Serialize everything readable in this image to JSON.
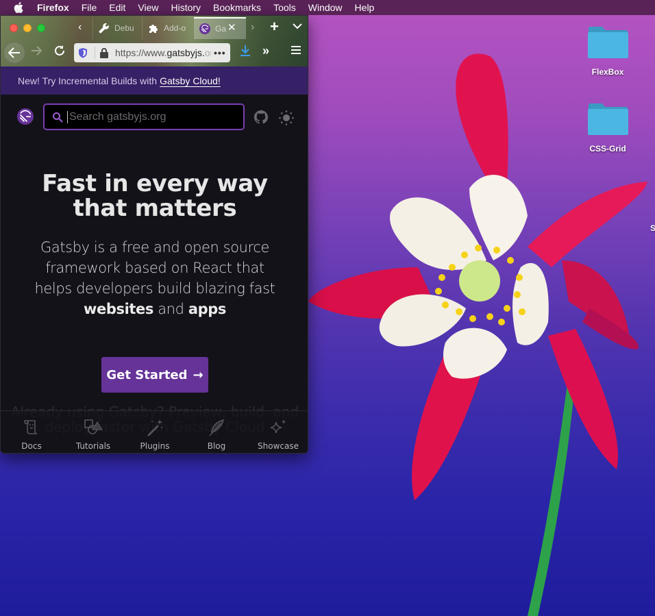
{
  "menubar": {
    "app_name": "Firefox",
    "items": [
      "File",
      "Edit",
      "View",
      "History",
      "Bookmarks",
      "Tools",
      "Window",
      "Help"
    ]
  },
  "desktop": {
    "icons": [
      {
        "label": "FlexBox",
        "icon": "folder-icon"
      },
      {
        "label": "CSS-Grid",
        "icon": "folder-icon"
      }
    ],
    "partial_label": "S"
  },
  "browser": {
    "tabs": [
      {
        "label": "Debu",
        "icon": "wrench-icon",
        "active": false
      },
      {
        "label": "Add-o",
        "icon": "puzzle-icon",
        "active": false
      },
      {
        "label": "Ga",
        "icon": "gatsby-icon",
        "active": true
      }
    ],
    "url_prefix": "https://www.",
    "url_domain": "gatsbyjs.",
    "url_suffix": "org",
    "page_actions": "•••"
  },
  "page": {
    "banner_text": "New! Try Incremental Builds with",
    "banner_link": "Gatsby Cloud!",
    "search_placeholder": "Search gatsbyjs.org",
    "hero_title_line1": "Fast in every way",
    "hero_title_line2": "that matters",
    "hero_text_1": "Gatsby is a free and open source framework based on React that helps developers build blazing fast",
    "hero_strong_1": "websites",
    "hero_text_2": "and",
    "hero_strong_2": "apps",
    "cta_label": "Get Started",
    "cta_arrow": "→",
    "ghost_text": "Already using Gatsby? Preview, build, and deploy faster with Gatsby Cloud",
    "bottom_nav": [
      {
        "label": "Docs",
        "icon": "docs-scroll-icon"
      },
      {
        "label": "Tutorials",
        "icon": "shapes-icon"
      },
      {
        "label": "Plugins",
        "icon": "magic-wand-icon"
      },
      {
        "label": "Blog",
        "icon": "feather-icon"
      },
      {
        "label": "Showcase",
        "icon": "sparkle-icon"
      }
    ]
  },
  "colors": {
    "gatsby_purple": "#663399",
    "banner_bg": "#362066",
    "page_bg": "#141219",
    "search_border": "#7a3fb5"
  }
}
